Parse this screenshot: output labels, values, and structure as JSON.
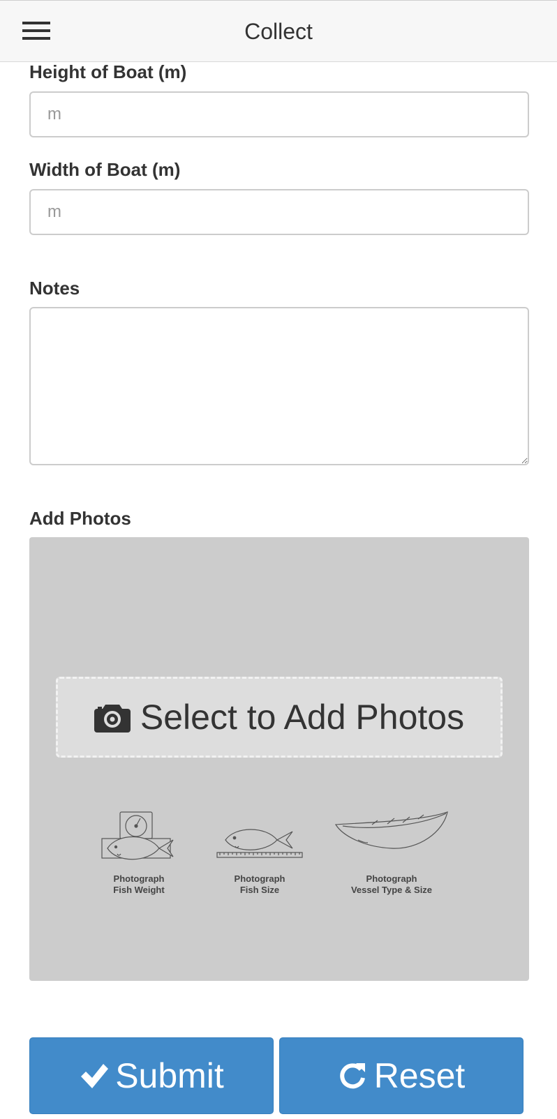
{
  "header": {
    "title": "Collect",
    "menu_icon": "hamburger-menu-icon"
  },
  "form": {
    "height": {
      "label": "Height of Boat (m)",
      "placeholder": "m",
      "value": ""
    },
    "width": {
      "label": "Width of Boat (m)",
      "placeholder": "m",
      "value": ""
    },
    "notes": {
      "label": "Notes",
      "value": ""
    },
    "photos": {
      "label": "Add Photos",
      "select_label": "Select to Add Photos",
      "select_icon": "camera-icon",
      "illustrations": [
        {
          "icon": "fish-on-scale-icon",
          "line1": "Photograph",
          "line2": "Fish Weight"
        },
        {
          "icon": "fish-on-ruler-icon",
          "line1": "Photograph",
          "line2": "Fish Size"
        },
        {
          "icon": "boat-icon",
          "line1": "Photograph",
          "line2": "Vessel Type & Size"
        }
      ]
    }
  },
  "actions": {
    "submit": {
      "label": "Submit",
      "icon": "checkmark-icon"
    },
    "reset": {
      "label": "Reset",
      "icon": "refresh-icon"
    }
  },
  "colors": {
    "primary_button": "#428bca",
    "photo_area": "#cccccc",
    "header_bg": "#f7f7f7"
  }
}
